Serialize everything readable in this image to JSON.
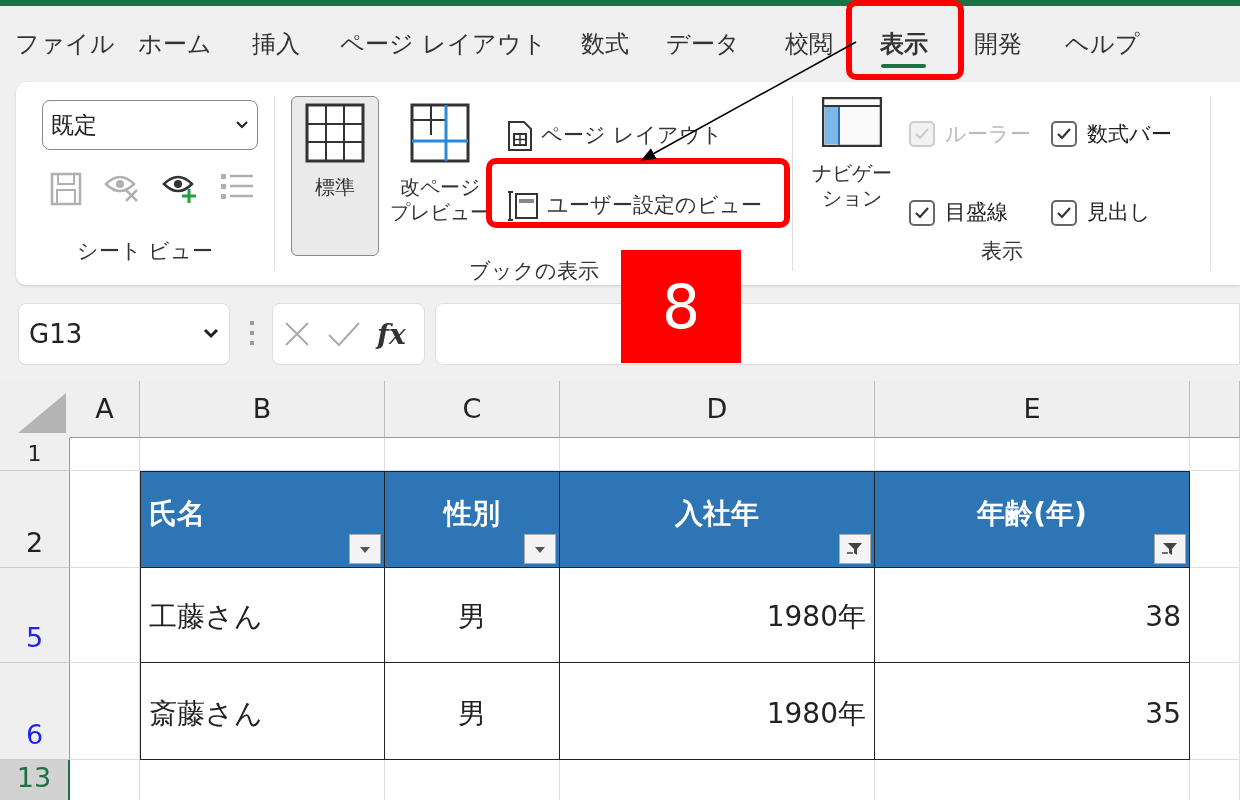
{
  "tabs": [
    {
      "label": "ファイル",
      "selected": false
    },
    {
      "label": "ホーム",
      "selected": false
    },
    {
      "label": "挿入",
      "selected": false
    },
    {
      "label": "ページ レイアウト",
      "selected": false
    },
    {
      "label": "数式",
      "selected": false
    },
    {
      "label": "データ",
      "selected": false
    },
    {
      "label": "校閲",
      "selected": false
    },
    {
      "label": "表示",
      "selected": true
    },
    {
      "label": "開発",
      "selected": false
    },
    {
      "label": "ヘルプ",
      "selected": false
    }
  ],
  "ribbon": {
    "sheet_view": {
      "label": "シート ビュー",
      "view_select": {
        "value": "既定"
      },
      "buttons": [
        {
          "kind": "save",
          "disabled": true
        },
        {
          "kind": "exit",
          "disabled": true
        },
        {
          "kind": "new",
          "disabled": false
        },
        {
          "kind": "options",
          "disabled": true
        }
      ]
    },
    "workbook_views": {
      "label": "ブックの表示",
      "large_buttons": [
        {
          "kind": "normal",
          "label": [
            "標準"
          ],
          "selected": true
        },
        {
          "kind": "pagebreak",
          "label": [
            "改ページ",
            "プレビュー"
          ],
          "selected": false
        }
      ],
      "small_buttons": [
        {
          "kind": "layout",
          "label": "ページ レイアウト"
        },
        {
          "kind": "custom",
          "label": "ユーザー設定のビュー"
        }
      ]
    },
    "show": {
      "label": "表示",
      "navigation": {
        "label": [
          "ナビゲー",
          "ション"
        ]
      },
      "checkboxes": [
        {
          "label": "ルーラー",
          "checked": true,
          "disabled": true
        },
        {
          "label": "数式バー",
          "checked": true,
          "disabled": false
        },
        {
          "label": "目盛線",
          "checked": true,
          "disabled": false
        },
        {
          "label": "見出し",
          "checked": true,
          "disabled": false
        }
      ]
    }
  },
  "formula_bar": {
    "name_box": "G13",
    "function_label": "fx"
  },
  "sheet": {
    "columns": [
      "A",
      "B",
      "C",
      "D",
      "E"
    ],
    "rows": [
      {
        "label": "1",
        "filtered": false,
        "selected": false
      },
      {
        "label": "2",
        "filtered": false,
        "selected": false
      },
      {
        "label": "5",
        "filtered": true,
        "selected": false
      },
      {
        "label": "6",
        "filtered": true,
        "selected": false
      },
      {
        "label": "13",
        "filtered": false,
        "selected": true
      }
    ],
    "table": {
      "header": [
        {
          "text": "氏名",
          "filtered": false
        },
        {
          "text": "性別",
          "filtered": false
        },
        {
          "text": "入社年",
          "filtered": true
        },
        {
          "text": "年齢(年)",
          "filtered": true
        }
      ],
      "rows": [
        [
          "工藤さん",
          "男",
          "1980年",
          "38"
        ],
        [
          "斎藤さん",
          "男",
          "1980年",
          "35"
        ]
      ]
    }
  },
  "annotation": {
    "step": "8"
  }
}
